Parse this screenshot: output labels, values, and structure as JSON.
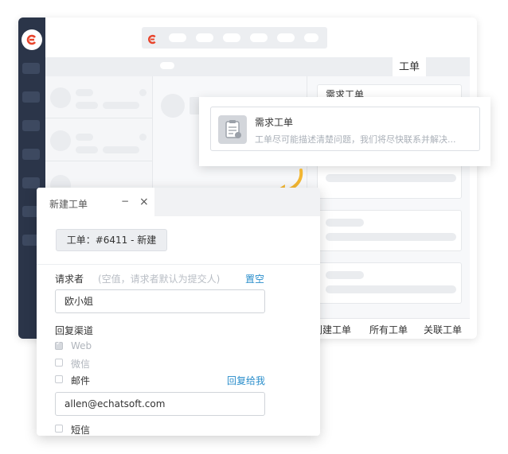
{
  "app": {
    "tab_label": "工单",
    "bottom_tabs": [
      "创建工单",
      "所有工单",
      "关联工单"
    ],
    "right_header_fragment": "需求工单"
  },
  "request_popup": {
    "title": "需求工单",
    "description": "工单尽可能描述清楚问题，我们将尽快联系并解决..."
  },
  "panel": {
    "title": "新建工单",
    "minimize_icon": "−",
    "close_icon": "×",
    "workorder_badge": "工单：#6411 - 新建",
    "requester_label": "请求者",
    "requester_hint": "(空值，请求者默认为提交人)",
    "clear_link": "置空",
    "requester_value": "欧小姐",
    "reply_channel_label": "回复渠道",
    "channels": [
      {
        "label": "Web",
        "checked": true,
        "disabled": true
      },
      {
        "label": "微信",
        "checked": false,
        "disabled": true
      },
      {
        "label": "邮件",
        "checked": false,
        "disabled": false
      },
      {
        "label": "短信",
        "checked": false,
        "disabled": false
      }
    ],
    "reply_to_me_link": "回复给我",
    "email_value": "allen@echatsoft.com"
  },
  "colors": {
    "sidebar": "#2b3549",
    "brand": "#e8452c",
    "link": "#2a8ecb",
    "arrow": "#f2b632"
  },
  "icons": {
    "logo": "echat-logo-icon",
    "request": "document-icon",
    "arrow": "curved-arrow-icon"
  }
}
